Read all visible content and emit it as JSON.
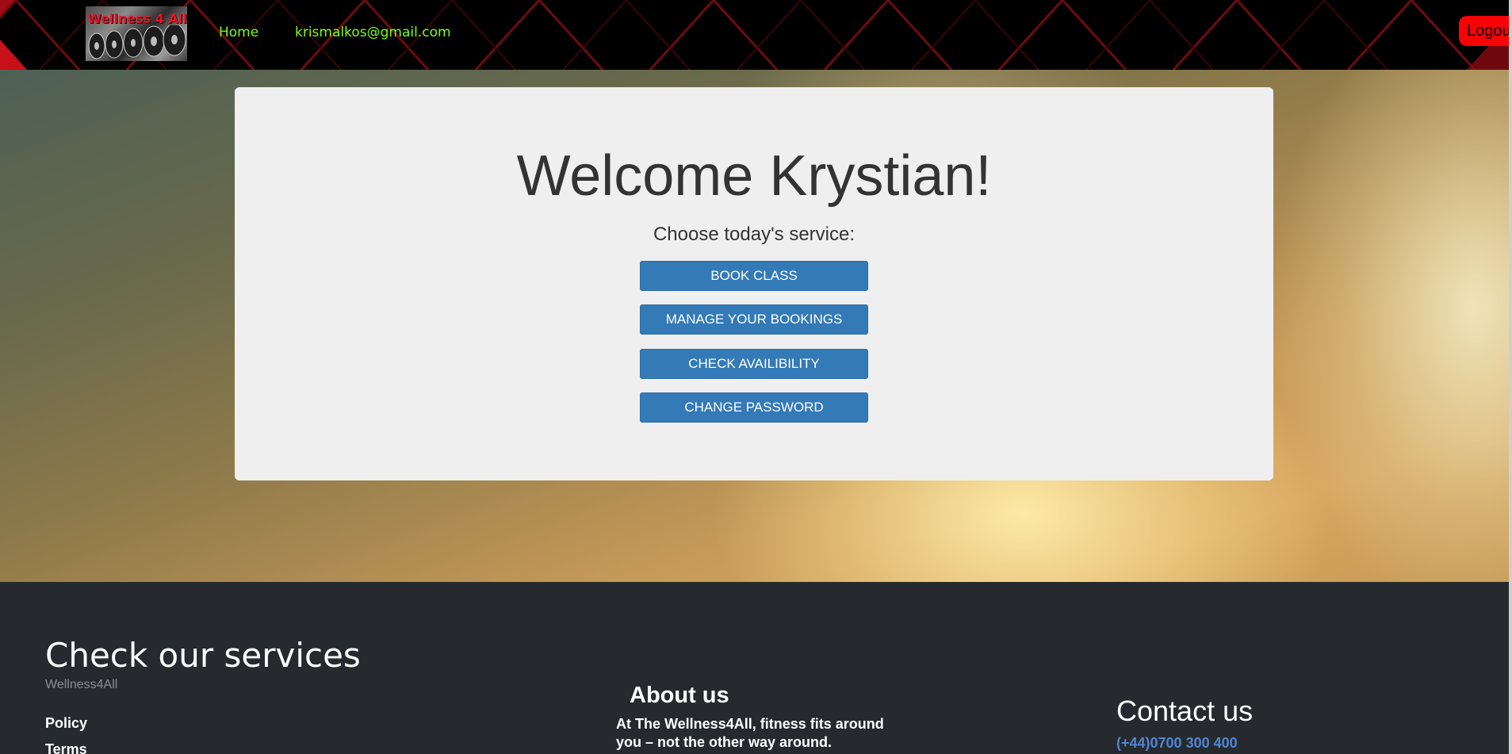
{
  "navbar": {
    "logo_text": "Wellness 4 All",
    "home_label": "Home",
    "email_label": "krismalkos@gmail.com",
    "logout_label": "Logout"
  },
  "welcome": {
    "title": "Welcome Krystian!",
    "subtitle": "Choose today's service:",
    "buttons": [
      {
        "label": "BOOK CLASS"
      },
      {
        "label": "MANAGE YOUR BOOKINGS"
      },
      {
        "label": "CHECK AVAILIBILITY"
      },
      {
        "label": "CHANGE PASSWORD"
      }
    ]
  },
  "footer": {
    "services_title": "Check our services",
    "brand": "Wellness4All",
    "links": [
      {
        "label": "Policy"
      },
      {
        "label": "Terms"
      }
    ],
    "about_title": "About us",
    "about_text": "At The Wellness4All, fitness fits around you – not the other way around.",
    "contact_title": "Contact us",
    "contact_phone": "(+44)0700 300 400"
  },
  "colors": {
    "nav_link": "#7dfc18",
    "logout_bg": "#fb0007",
    "primary_button": "#337ab7",
    "footer_bg": "#262a2e",
    "card_bg": "#efefef",
    "phone_link": "#4f86d6"
  }
}
